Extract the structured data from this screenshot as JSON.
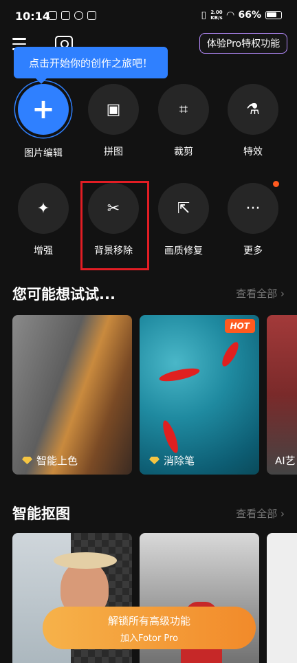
{
  "status_bar": {
    "time": "10:14",
    "speed_value": "2.00",
    "speed_unit": "KB/s",
    "battery": "66%"
  },
  "header": {
    "pro_button": "体验Pro特权功能",
    "tooltip": "点击开始你的创作之旅吧！"
  },
  "tools": [
    {
      "label": "图片编辑",
      "icon": "plus-icon",
      "glyph": "+"
    },
    {
      "label": "拼图",
      "icon": "collage-icon",
      "glyph": "▣"
    },
    {
      "label": "裁剪",
      "icon": "crop-icon",
      "glyph": "⌗"
    },
    {
      "label": "特效",
      "icon": "flask-icon",
      "glyph": "⚗"
    },
    {
      "label": "增强",
      "icon": "magic-wand-icon",
      "glyph": "✦"
    },
    {
      "label": "背景移除",
      "icon": "scissors-icon",
      "glyph": "✂"
    },
    {
      "label": "画质修复",
      "icon": "resize-icon",
      "glyph": "⇱"
    },
    {
      "label": "更多",
      "icon": "more-dots-icon",
      "glyph": "···"
    }
  ],
  "suggestions": {
    "title": "您可能想试试...",
    "see_all": "查看全部",
    "cards": [
      {
        "label": "智能上色",
        "premium": true
      },
      {
        "label": "消除笔",
        "premium": true,
        "badge": "HOT"
      },
      {
        "label": "AI艺"
      }
    ]
  },
  "cutout": {
    "title": "智能抠图",
    "see_all": "查看全部"
  },
  "unlock": {
    "line1": "解锁所有高级功能",
    "line2": "加入Fotor Pro"
  },
  "colors": {
    "accent": "#2f80ff",
    "highlight": "#e21d24",
    "pro_border": "#b78cff",
    "cta": "#f28a2a"
  }
}
